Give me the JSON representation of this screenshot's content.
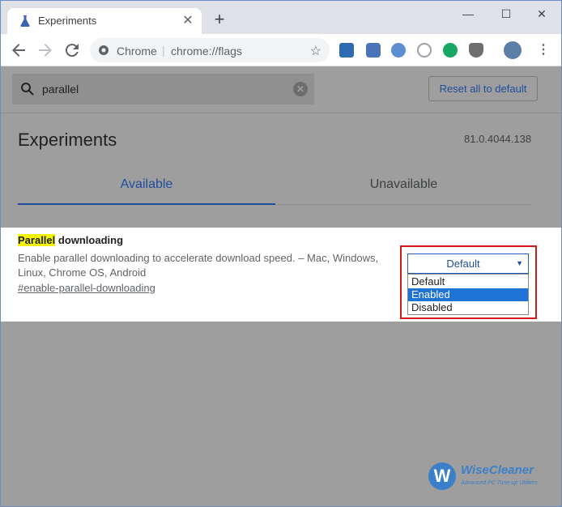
{
  "window": {
    "tab_title": "Experiments",
    "new_tab_label": "+",
    "minimize_label": "—",
    "maximize_label": "☐",
    "close_label": "✕"
  },
  "toolbar": {
    "omnibox_host": "Chrome",
    "omnibox_separator": "|",
    "omnibox_url": "chrome://flags",
    "star_icon": "☆",
    "menu_icon": "⋮"
  },
  "flags": {
    "search_value": "parallel",
    "search_clear": "✕",
    "reset_button": "Reset all to default",
    "title": "Experiments",
    "version": "81.0.4044.138",
    "tab_available": "Available",
    "tab_unavailable": "Unavailable"
  },
  "experiment": {
    "title_highlight": "Parallel",
    "title_rest": " downloading",
    "description": "Enable parallel downloading to accelerate download speed. – Mac, Windows, Linux, Chrome OS, Android",
    "link": "#enable-parallel-downloading",
    "select_value": "Default",
    "select_arrow": "▼",
    "options": [
      "Default",
      "Enabled",
      "Disabled"
    ],
    "highlighted_option": "Enabled"
  },
  "watermark": {
    "logo_letter": "W",
    "brand": "WiseCleaner",
    "tagline": "Advanced PC Tune-up Utilities"
  },
  "colors": {
    "accent": "#1f4d9c",
    "highlight": "#f3f300",
    "annotation": "#d11a1a",
    "selected_option": "#1e73d6"
  }
}
